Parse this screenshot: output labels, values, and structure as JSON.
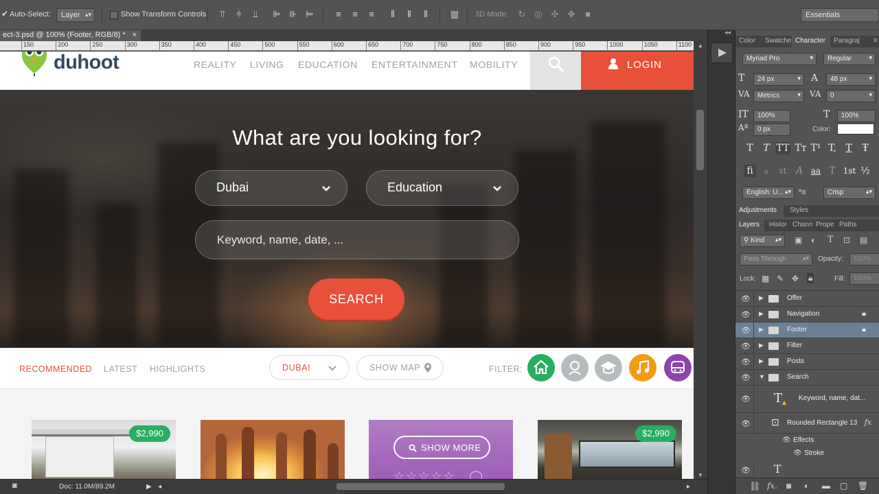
{
  "photoshop": {
    "options": {
      "auto_select_label": "Auto-Select:",
      "auto_select_value": "Layer",
      "transform_label": "Show Transform Controls",
      "mode_3d_label": "3D Mode:",
      "workspace": "Essentials"
    },
    "document_tab": "ect-3.psd @ 100% (Footer, RGB/8) *",
    "ruler_labels": [
      "150",
      "200",
      "250",
      "300",
      "350",
      "400",
      "450",
      "500",
      "550",
      "600",
      "650",
      "700",
      "750",
      "800",
      "850",
      "900",
      "950",
      "1000",
      "1050",
      "1100"
    ],
    "status": {
      "doc_size": "Doc: 11.0M/89.2M"
    }
  },
  "panels": {
    "top_tabs": [
      "Color",
      "Swatche",
      "Character",
      "Paragraj"
    ],
    "character": {
      "font_family": "Myriad Pro",
      "font_style": "Regular",
      "font_size": "24 px",
      "leading": "48 px",
      "kerning": "Metrics",
      "tracking": "0",
      "vertical_scale": "100%",
      "horizontal_scale": "100%",
      "baseline_shift": "0 px",
      "color_label": "Color:",
      "color_value": "#ffffff",
      "type_buttons": [
        "T",
        "T",
        "TT",
        "Tт",
        "T¹",
        "T,",
        "T",
        "Ŧ"
      ],
      "opentype_buttons": [
        "fi",
        "ℴ",
        "st",
        "A",
        "aa",
        "T",
        "1st",
        "½"
      ],
      "language": "English: U...",
      "aa_label": "ªa",
      "antialias": "Crisp"
    },
    "mid_tabs": [
      "Adjustments",
      "Styles"
    ],
    "layers_tabs": [
      "Layers",
      "Histor",
      "Chann",
      "Prope",
      "Paths"
    ],
    "layers_controls": {
      "kind": "Kind",
      "blend": "Pass Through",
      "opacity_label": "Opacity:",
      "opacity_value": "100%",
      "lock_label": "Lock:",
      "fill_label": "Fill:",
      "fill_value": "100%"
    },
    "layers": [
      {
        "name": "Offer",
        "locked": false,
        "selected": false
      },
      {
        "name": "Navigation",
        "locked": true,
        "selected": false
      },
      {
        "name": "Footer",
        "locked": true,
        "selected": true
      },
      {
        "name": "Filter",
        "locked": false,
        "selected": false
      },
      {
        "name": "Posts",
        "locked": false,
        "selected": false
      },
      {
        "name": "Search",
        "locked": false,
        "selected": false,
        "expanded": true
      }
    ],
    "sublayers": {
      "text_layer": "Keyword, name, dat...",
      "shape_layer": "Rounded Rectangle 13",
      "fx_label": "fx",
      "effects_label": "Effects",
      "stroke_label": "Stroke"
    }
  },
  "site": {
    "logo": "duhoot",
    "nav": [
      "REALITY",
      "LIVING",
      "EDUCATION",
      "ENTERTAINMENT",
      "MOBILITY"
    ],
    "login": "LOGIN",
    "hero_title": "What are you looking for?",
    "city": "Dubai",
    "category": "Education",
    "keyword_placeholder": "Keyword, name, date, ...",
    "search_button": "SEARCH",
    "filter_tabs": [
      "RECOMMENDED",
      "LATEST",
      "HIGHLIGHTS"
    ],
    "location_pill": "DUBAI",
    "show_map": "SHOW MAP",
    "filter_label": "FILTER:",
    "filter_icons": [
      {
        "name": "home-icon",
        "color": "#27ae60"
      },
      {
        "name": "person-icon",
        "color": "#b6bcbe"
      },
      {
        "name": "graduation-cap-icon",
        "color": "#b6bcbe"
      },
      {
        "name": "music-icon",
        "color": "#f39c12"
      },
      {
        "name": "bus-icon",
        "color": "#8e44ad"
      }
    ],
    "cards": [
      {
        "price": "$2,990"
      },
      {
        "price": ""
      },
      {
        "button": "SHOW MORE"
      },
      {
        "price": "$2,990"
      }
    ],
    "colors": {
      "accent": "#e8503a",
      "green": "#27ae60",
      "purple": "#9b59b6",
      "navy": "#34495e"
    }
  }
}
